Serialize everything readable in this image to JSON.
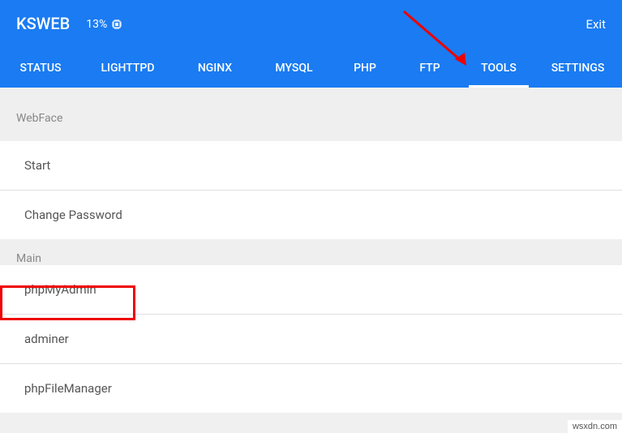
{
  "header": {
    "title": "KSWEB",
    "battery": "13%",
    "exit": "Exit"
  },
  "tabs": {
    "status": "STATUS",
    "lighttpd": "LIGHTTPD",
    "nginx": "NGINX",
    "mysql": "MYSQL",
    "php": "PHP",
    "ftp": "FTP",
    "tools": "TOOLS",
    "settings": "SETTINGS"
  },
  "sections": {
    "webface": {
      "label": "WebFace",
      "items": {
        "start": "Start",
        "change_password": "Change Password"
      }
    },
    "main": {
      "label": "Main",
      "items": {
        "phpmyadmin": "phpMyAdmin",
        "adminer": "adminer",
        "phpfilemanager": "phpFileManager"
      }
    }
  },
  "watermark": "wsxdn.com"
}
